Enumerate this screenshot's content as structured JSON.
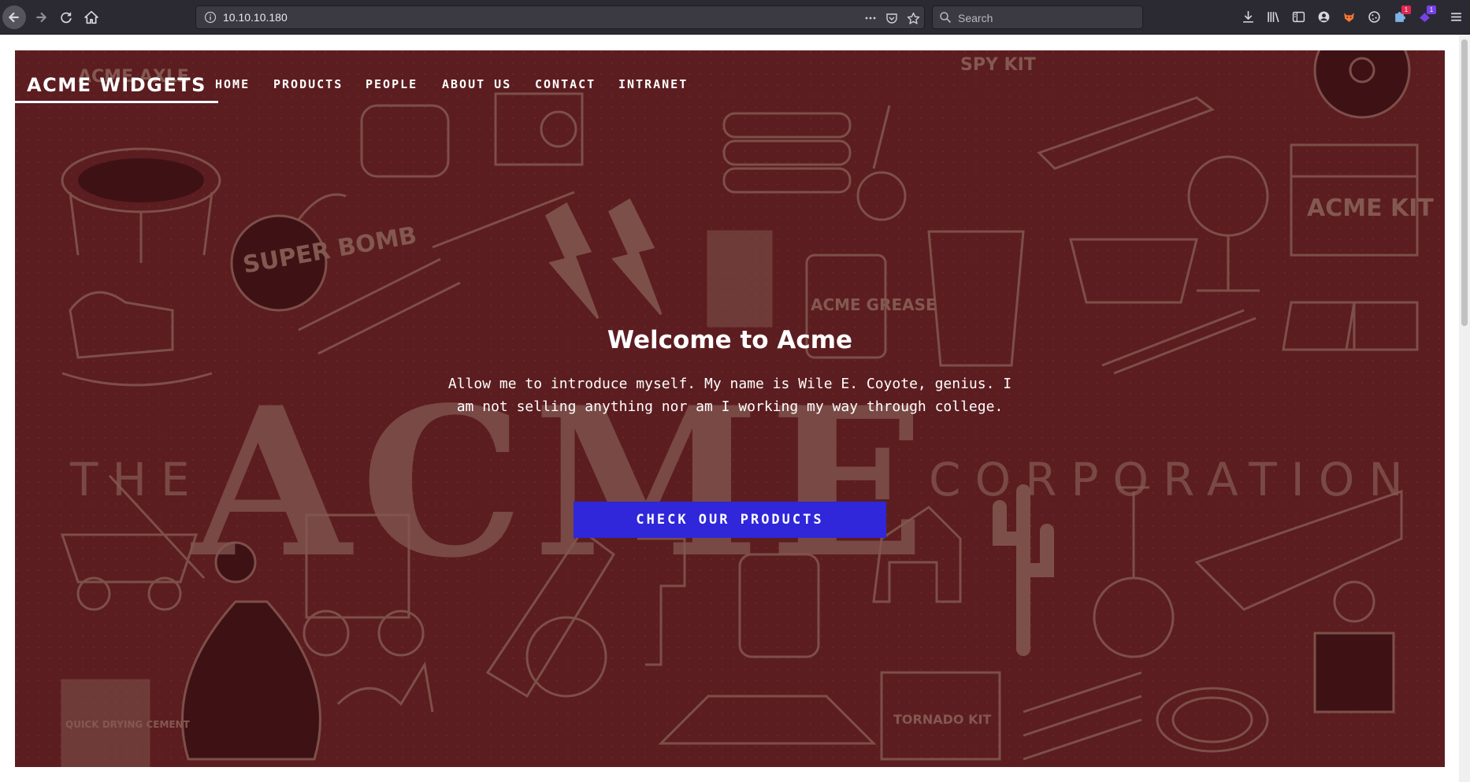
{
  "browser": {
    "url": "10.10.10.180",
    "search_placeholder": "Search",
    "badges": {
      "notifications_count": "1",
      "extension_count": "1"
    }
  },
  "site": {
    "brand": "ACME WIDGETS",
    "nav": [
      "HOME",
      "PRODUCTS",
      "PEOPLE",
      "ABOUT US",
      "CONTACT",
      "INTRANET"
    ],
    "hero": {
      "title": "Welcome to Acme",
      "paragraph": "Allow me to introduce myself. My name is Wile E. Coyote, genius. I am not selling anything nor am I working my way through college.",
      "cta_label": "CHECK OUR PRODUCTS"
    },
    "poster_text": {
      "the": "THE",
      "acme": "ACME",
      "corporation": "CORPORATION",
      "super_bomb": "SUPER BOMB",
      "acme_kit": "ACME KIT",
      "acme_grease": "ACME GREASE",
      "tornado_kit": "TORNADO KIT",
      "quick_drying_cement": "QUICK DRYING CEMENT",
      "acme_axle": "ACME AXLE",
      "spy_kit": "SPY KIT"
    }
  },
  "colors": {
    "toolbar_bg": "#2b2a33",
    "hero_bg": "#5e1f22",
    "poster_ink": "#9a7a6e",
    "cta_bg": "#2f27d9",
    "badge_red": "#e22850",
    "badge_purple": "#7542e5"
  },
  "icons": [
    "back-icon",
    "forward-icon",
    "reload-icon",
    "home-icon",
    "info-icon",
    "more-icon",
    "pocket-icon",
    "bookmark-star-icon",
    "search-icon",
    "download-icon",
    "library-icon",
    "sidebar-icon",
    "account-icon",
    "extension-fox-icon",
    "extension-cookie-icon",
    "extension-puzzle-icon",
    "extension-purple-icon",
    "menu-icon"
  ]
}
